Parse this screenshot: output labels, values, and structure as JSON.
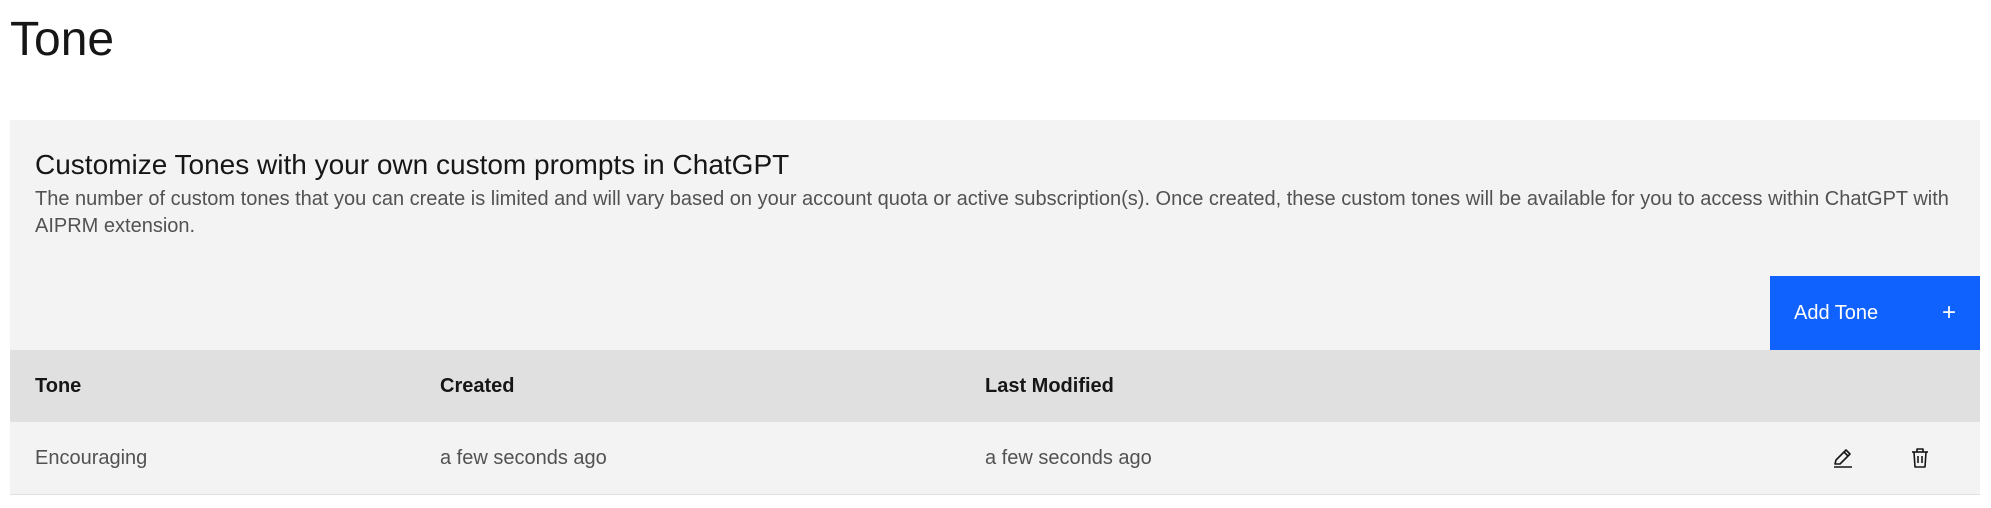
{
  "page": {
    "title": "Tone"
  },
  "panel": {
    "heading": "Customize Tones with your own custom prompts in ChatGPT",
    "description": "The number of custom tones that you can create is limited and will vary based on your account quota or active subscription(s). Once created, these custom tones will be available for you to access within ChatGPT with AIPRM extension.",
    "add_button_label": "Add Tone",
    "add_button_icon": "plus-icon",
    "accent_color": "#0f62fe"
  },
  "table": {
    "columns": [
      "Tone",
      "Created",
      "Last Modified"
    ],
    "rows": [
      {
        "tone": "Encouraging",
        "created": "a few seconds ago",
        "modified": "a few seconds ago",
        "actions": [
          "edit-icon",
          "trash-icon"
        ]
      }
    ]
  }
}
